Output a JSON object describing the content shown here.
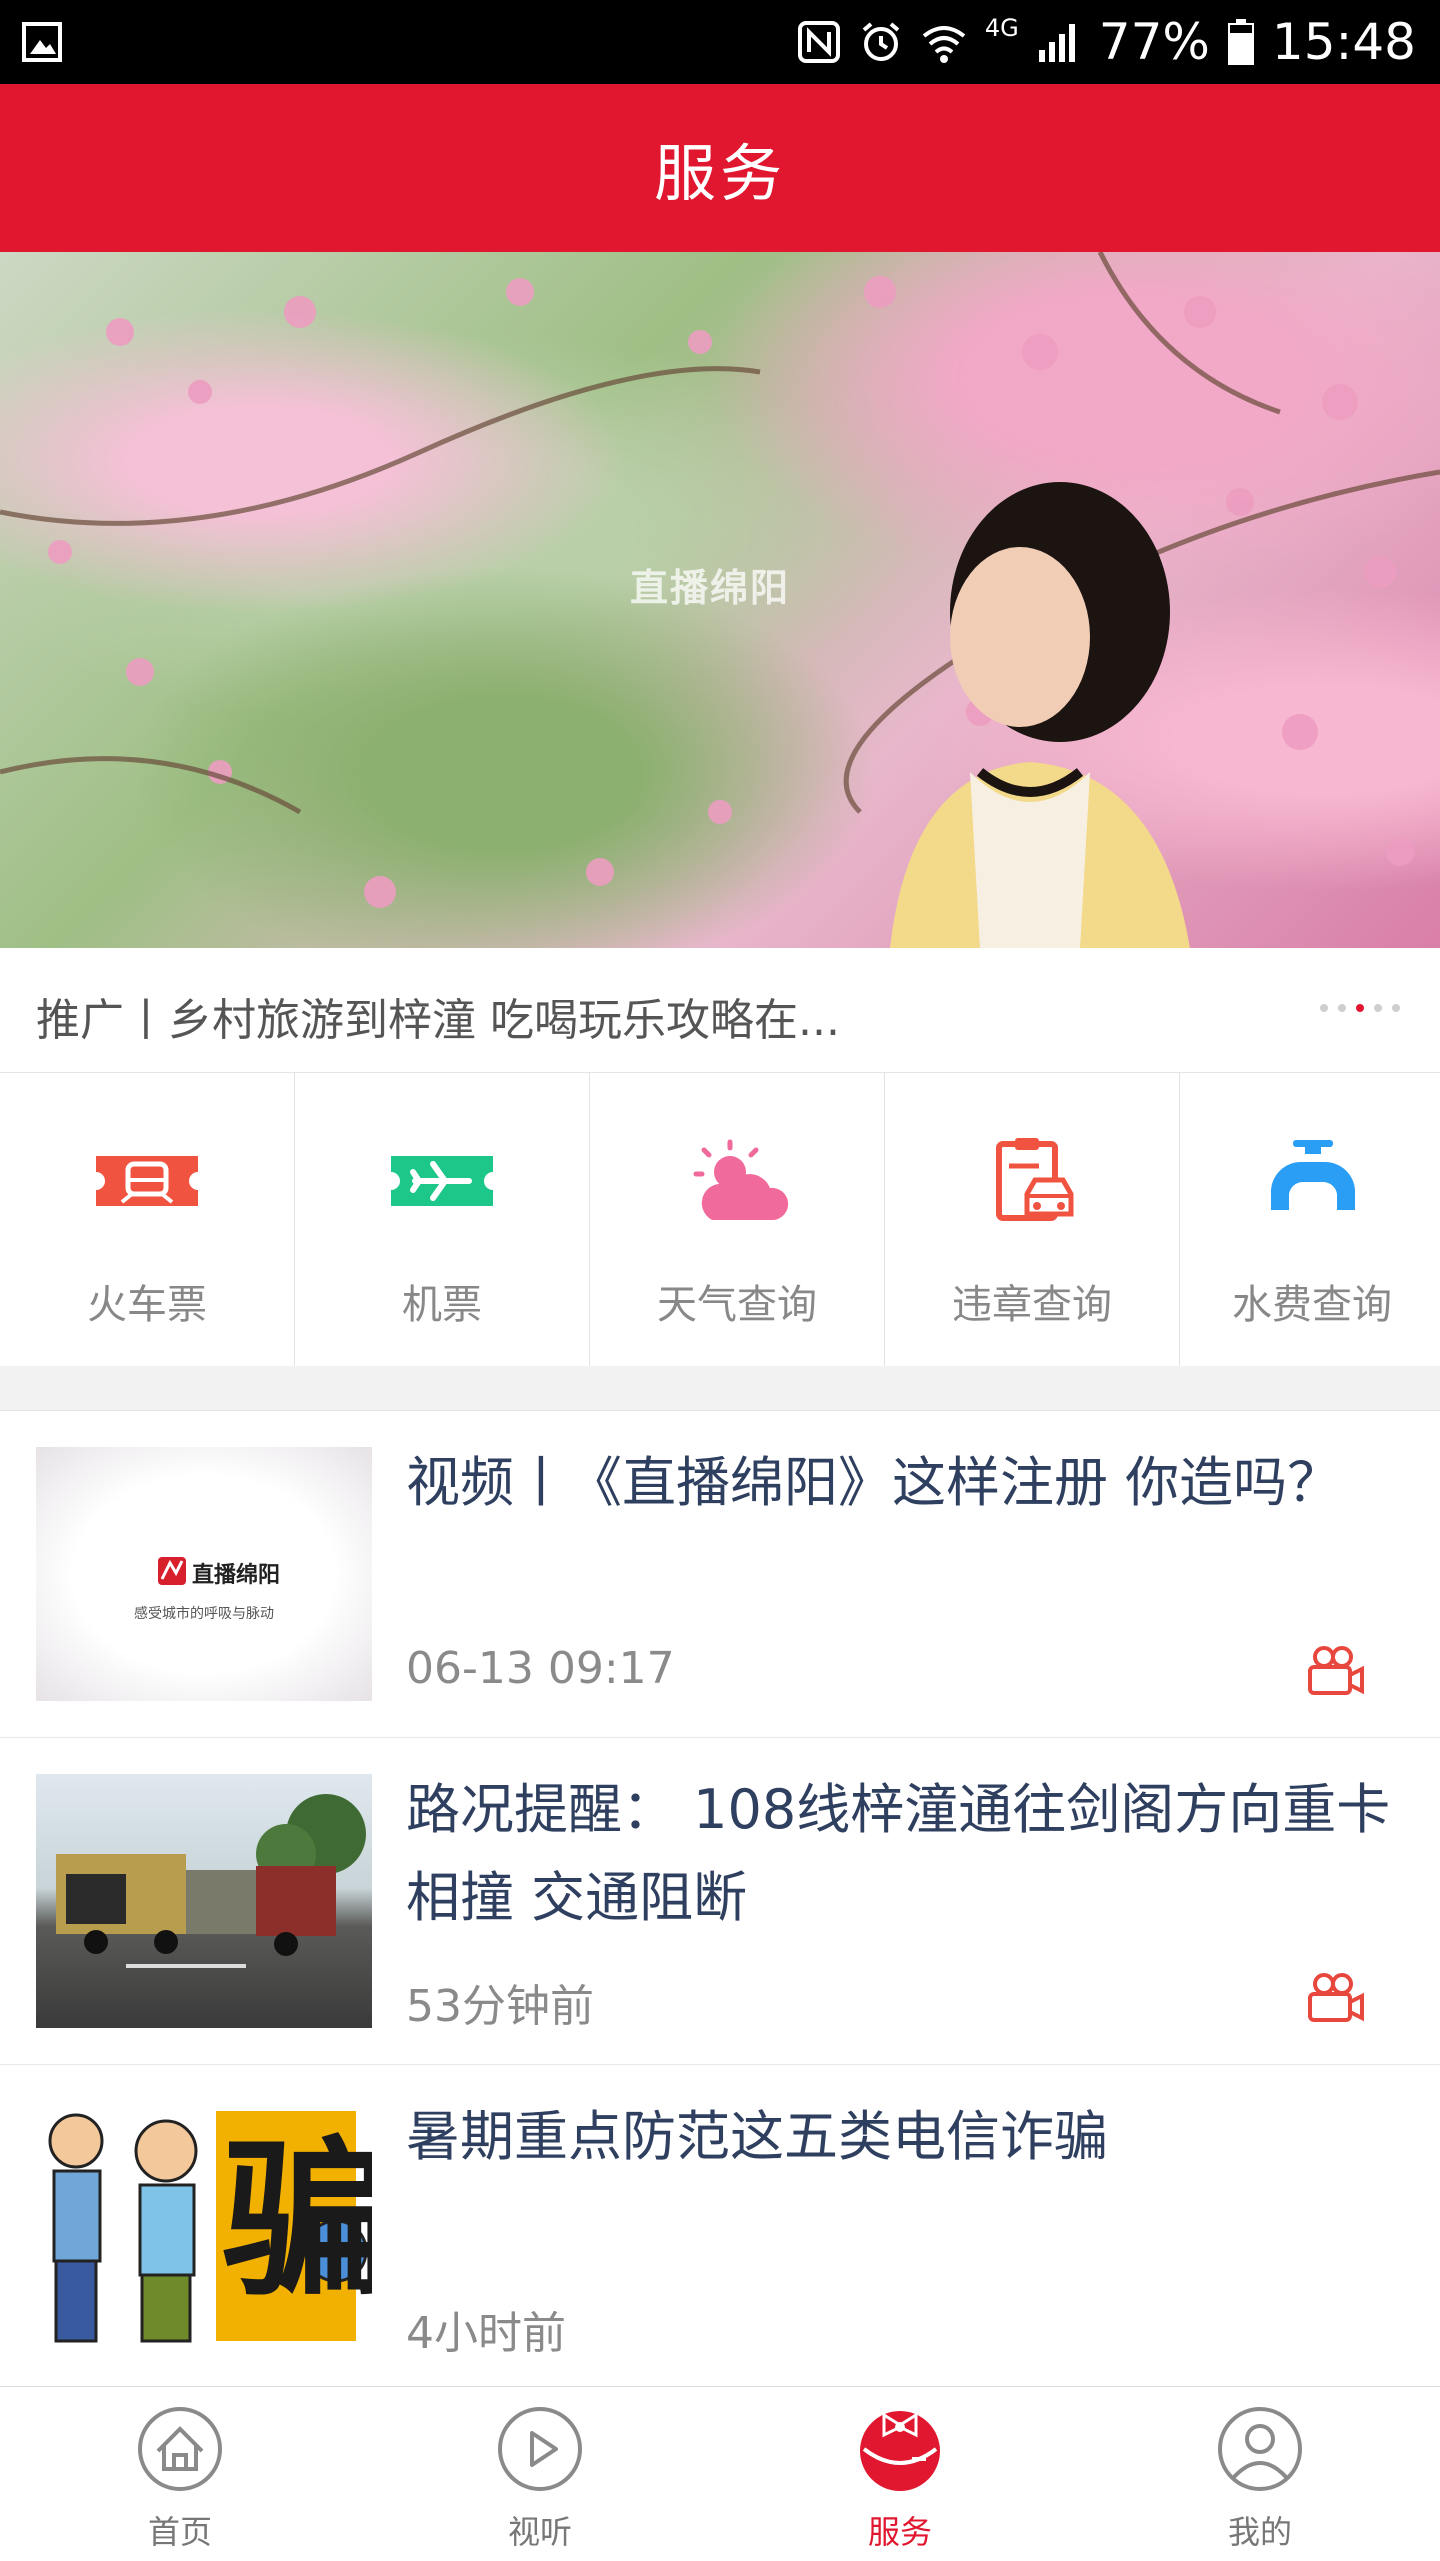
{
  "status_bar": {
    "battery": "77%",
    "time": "15:48",
    "network": "4G"
  },
  "header": {
    "title": "服务"
  },
  "banner": {
    "watermark": "直播绵阳",
    "caption": "推广丨乡村旅游到梓潼  吃喝玩乐攻略在...",
    "active_dot": 2,
    "dot_count": 5
  },
  "services": [
    {
      "label": "火车票",
      "icon": "train-ticket-icon",
      "color": "#f0533f"
    },
    {
      "label": "机票",
      "icon": "plane-ticket-icon",
      "color": "#1dc78a"
    },
    {
      "label": "天气查询",
      "icon": "weather-icon",
      "color": "#f06a9c"
    },
    {
      "label": "违章查询",
      "icon": "traffic-violation-icon",
      "color": "#f0533f"
    },
    {
      "label": "水费查询",
      "icon": "water-tap-icon",
      "color": "#2a9df4"
    }
  ],
  "news": [
    {
      "title": "视频丨《直播绵阳》这样注册  你造吗？",
      "time": "06-13 09:17",
      "thumb_logo": "直播绵阳",
      "thumb_slogan": "感受城市的呼吸与脉动",
      "has_video": true
    },
    {
      "title": "路况提醒：  108线梓潼通往剑阁方向重卡相撞  交通阻断",
      "time": "53分钟前",
      "has_video": true
    },
    {
      "title": "暑期重点防范这五类电信诈骗",
      "time": "4小时前",
      "thumb_text": "骗",
      "has_video": false
    }
  ],
  "bottom_nav": [
    {
      "label": "首页",
      "icon": "home-icon",
      "active": false
    },
    {
      "label": "视听",
      "icon": "play-icon",
      "active": false
    },
    {
      "label": "服务",
      "icon": "service-icon",
      "active": true
    },
    {
      "label": "我的",
      "icon": "profile-icon",
      "active": false
    }
  ],
  "colors": {
    "brand_red": "#e0172f",
    "title_text": "#2f3f5f",
    "muted_text": "#8a8a8a"
  }
}
